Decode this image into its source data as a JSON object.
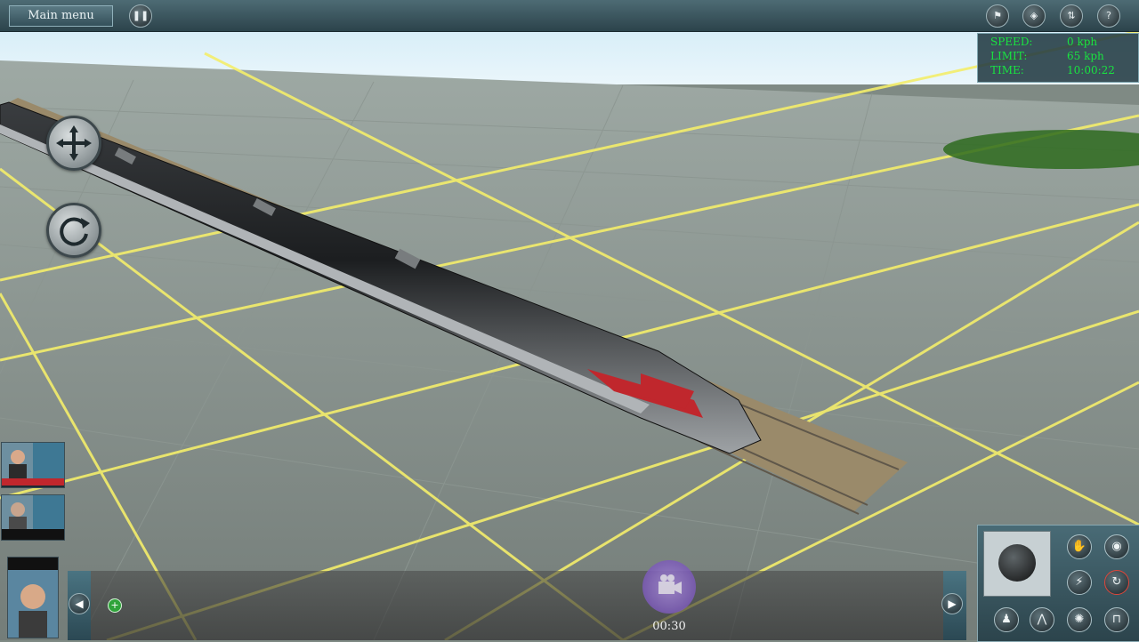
{
  "topbar": {
    "main_menu_label": "Main menu",
    "pause_icon": "pause-icon",
    "right_icons": [
      "finish-flag-icon",
      "layers-icon",
      "signal-icon",
      "help-icon"
    ]
  },
  "hud": {
    "speed_label": "SPEED:",
    "speed_value": "0 kph",
    "limit_label": "LIMIT:",
    "limit_value": "65 kph",
    "time_label": "TIME:",
    "time_value": "10:00:22",
    "text_color": "#19e340"
  },
  "camera_controls": {
    "move_icon": "move-arrows-icon",
    "rotate_icon": "rotate-icon"
  },
  "bottom_bar": {
    "left_arrow_icon": "arrow-left-icon",
    "right_arrow_icon": "arrow-right-icon",
    "add_icon": "green-plus-icon",
    "record_icon": "camera-icon",
    "elapsed_time": "00:30"
  },
  "control_panel": {
    "joystick_icon": "joystick-icon",
    "buttons": [
      "horn-icon",
      "view-icon",
      "power-icon",
      "reverse-icon",
      "bell-icon",
      "pantograph-icon",
      "light-icon",
      "coupler-icon"
    ]
  }
}
